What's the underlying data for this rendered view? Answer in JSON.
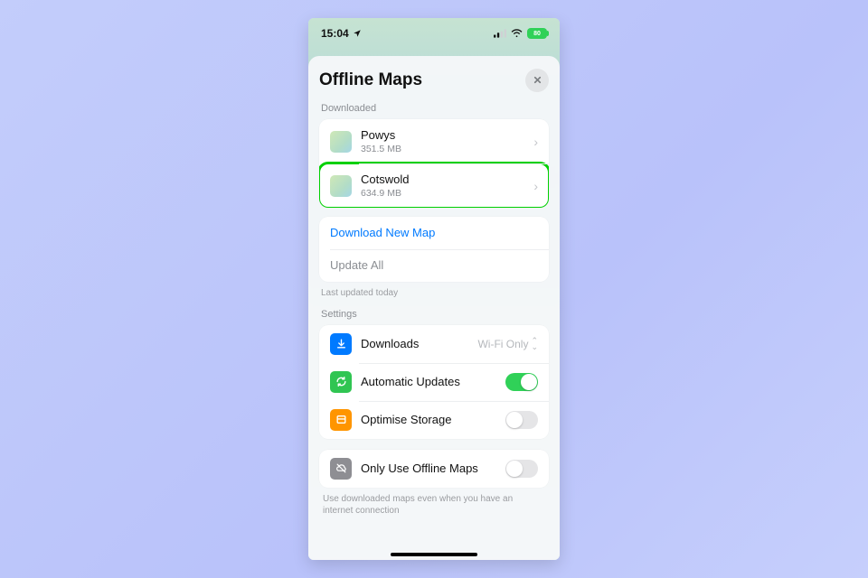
{
  "status_bar": {
    "time": "15:04",
    "battery_text": "80"
  },
  "sheet": {
    "title": "Offline Maps",
    "downloaded_label": "Downloaded",
    "maps": [
      {
        "name": "Powys",
        "size": "351.5 MB",
        "highlighted": false
      },
      {
        "name": "Cotswold",
        "size": "634.9 MB",
        "highlighted": true
      }
    ],
    "download_new": "Download New Map",
    "update_all": "Update All",
    "last_updated": "Last updated today",
    "settings_label": "Settings",
    "settings": {
      "downloads": {
        "label": "Downloads",
        "value": "Wi-Fi Only"
      },
      "automatic_updates": {
        "label": "Automatic Updates",
        "on": true
      },
      "optimise_storage": {
        "label": "Optimise Storage",
        "on": false
      },
      "only_offline": {
        "label": "Only Use Offline Maps",
        "on": false,
        "helper": "Use downloaded maps even when you have an internet connection"
      }
    }
  }
}
